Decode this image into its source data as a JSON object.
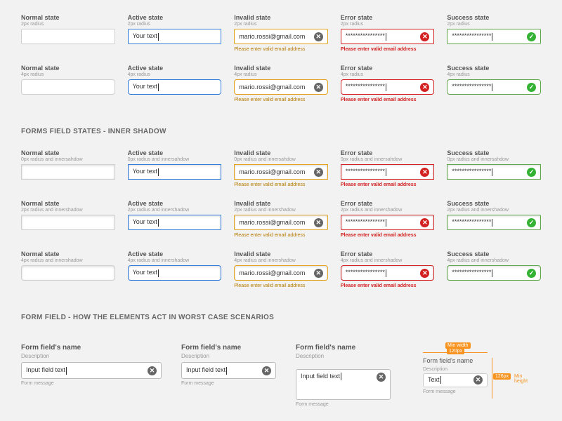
{
  "states": {
    "normal": {
      "title": "Normal state"
    },
    "active": {
      "title": "Active state",
      "value": "Your text"
    },
    "invalid": {
      "title": "Invalid state",
      "value": "mario.rossi@gmail.com",
      "msg": "Please enter valid email address"
    },
    "error": {
      "title": "Error state",
      "value": "****************",
      "msg": "Please enter valid email address"
    },
    "success": {
      "title": "Success state",
      "value": "****************"
    }
  },
  "subs": {
    "r2": "2px radius",
    "r4": "4px radius",
    "r0i": "0px radius and innersahdow",
    "r2i": "2px radius and innershadow",
    "r4i": "4px radius and innershadow"
  },
  "section_inner": "FORMS FIELD STATES - INNER SHADOW",
  "section_worst": "FORM FIELD - HOW THE ELEMENTS ACT IN WORST CASE SCENARIOS",
  "worst": {
    "name": "Form field's name",
    "desc": "Description",
    "value": "Input field text",
    "value_short": "Text",
    "msg": "Form message",
    "name_wrap": "Form field's name",
    "dims": {
      "minw_label": "Min width",
      "minw_val": "120px",
      "minh_label": "Min height",
      "minh_val": "126px"
    }
  },
  "icons": {
    "x": "✕",
    "check": "✓"
  }
}
